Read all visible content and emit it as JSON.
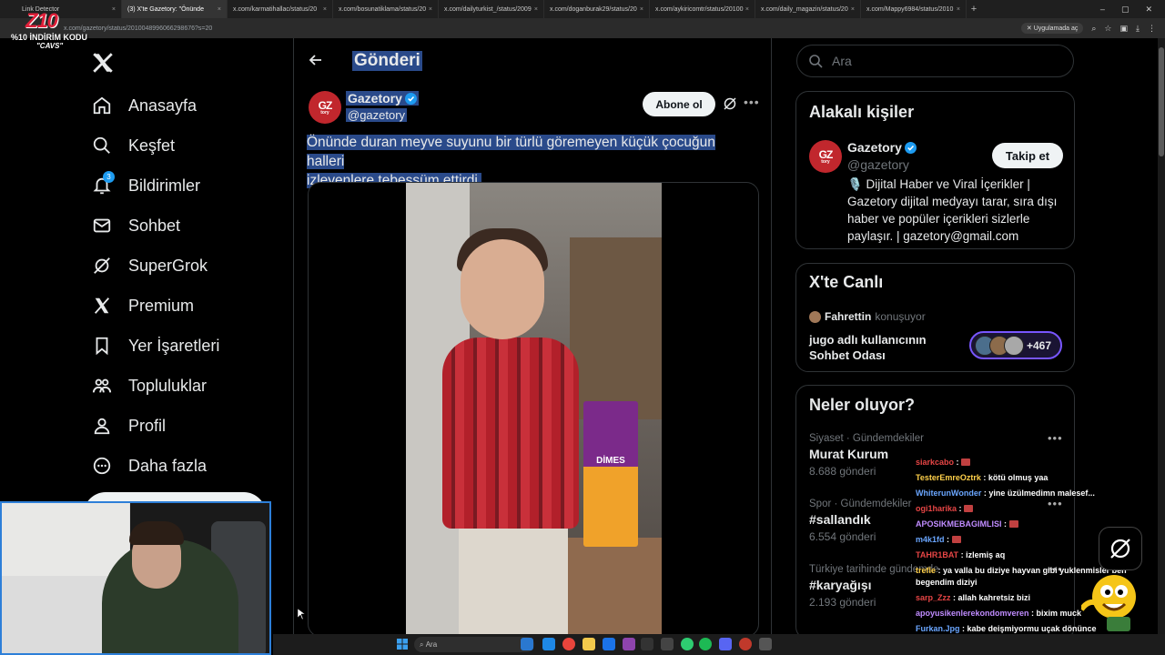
{
  "browser": {
    "tabs": [
      {
        "label": "Link Detector",
        "active": false
      },
      {
        "label": "(3) X'te Gazetory: \"Önünde",
        "active": true
      },
      {
        "label": "x.com/karmatihallac/status/20",
        "active": false
      },
      {
        "label": "x.com/bosunatiklama/status/20",
        "active": false
      },
      {
        "label": "x.com/dailyturkist_/status/2009",
        "active": false
      },
      {
        "label": "x.com/doganburak29/status/20",
        "active": false
      },
      {
        "label": "x.com/aykiricomtr/status/20100",
        "active": false
      },
      {
        "label": "x.com/daily_magazin/status/20",
        "active": false
      },
      {
        "label": "x.com/Mappy6984/status/2010",
        "active": false
      }
    ],
    "url": "x.com/gazetory/status/2010048996066298676?s=20",
    "open_in_app": "Uygulamada aç"
  },
  "stream_overlay": {
    "logo_mark": "Z10",
    "promo_text": "%10 İNDİRİM KODU",
    "promo_code": "\"CAVS\""
  },
  "nav": {
    "items": [
      {
        "label": "Anasayfa",
        "icon": "home-icon"
      },
      {
        "label": "Keşfet",
        "icon": "search-icon"
      },
      {
        "label": "Bildirimler",
        "icon": "bell-icon",
        "badge": "3"
      },
      {
        "label": "Sohbet",
        "icon": "mail-icon"
      },
      {
        "label": "SuperGrok",
        "icon": "grok-icon"
      },
      {
        "label": "Premium",
        "icon": "x-icon"
      },
      {
        "label": "Yer İşaretleri",
        "icon": "bookmark-icon"
      },
      {
        "label": "Topluluklar",
        "icon": "communities-icon"
      },
      {
        "label": "Profil",
        "icon": "profile-icon"
      },
      {
        "label": "Daha fazla",
        "icon": "more-circle-icon"
      }
    ]
  },
  "post": {
    "header_title": "Gönderi",
    "author_name": "Gazetory",
    "author_handle": "@gazetory",
    "avatar_text": "GZ",
    "avatar_sub": "tory",
    "subscribe_label": "Abone ol",
    "text_line1": "Önünde duran meyve suyunu bir türlü göremeyen küçük çocuğun halleri",
    "text_line2": "izleyenlere tebessüm ettirdi.",
    "video_product_label": "DİMES"
  },
  "search": {
    "placeholder": "Ara"
  },
  "related": {
    "title": "Alakalı kişiler",
    "name": "Gazetory",
    "handle": "@gazetory",
    "follow_label": "Takip et",
    "bio": "🎙️ Dijital Haber ve Viral İçerikler | Gazetory dijital medyayı tarar, sıra dışı haber ve popüler içerikleri sizlerle paylaşır. | gazetory@gmail.com"
  },
  "live": {
    "title": "X'te Canlı",
    "host": "Fahrettin",
    "host_status": "konuşuyor",
    "room_title": "jugo adlı kullanıcının Sohbet Odası",
    "listener_count": "+467"
  },
  "trends": {
    "title": "Neler oluyor?",
    "items": [
      {
        "meta": "Siyaset · Gündemdekiler",
        "name": "Murat Kurum",
        "count": "8.688 gönderi"
      },
      {
        "meta": "Spor · Gündemdekiler",
        "name": "#sallandık",
        "count": "6.554 gönderi"
      },
      {
        "meta": "Türkiye tarihinde gündemde",
        "name": "#karyağışı",
        "count": "2.193 gönderi"
      }
    ]
  },
  "chat": [
    {
      "user": "siarkcabo",
      "msg": "",
      "color": "red",
      "emoji": true
    },
    {
      "user": "TesterEmreOztrk",
      "msg": "kötü olmuş yaa",
      "color": "yellow"
    },
    {
      "user": "WhiterunWonder",
      "msg": "yine üzülmedimn malesef...",
      "color": "blue"
    },
    {
      "user": "ogi1harika",
      "msg": "",
      "color": "red",
      "emoji": true
    },
    {
      "user": "APOSIKMEBAGIMLISI",
      "msg": "",
      "color": "purple",
      "emoji": true
    },
    {
      "user": "m4k1fd",
      "msg": "",
      "color": "blue",
      "emoji": true
    },
    {
      "user": "TAHR1BAT",
      "msg": "izlemiş aq",
      "color": "red"
    },
    {
      "user": "trefle",
      "msg": "ya valla bu diziye hayvan gibi yuklenmisler ben begendim diziyi",
      "color": "yellow",
      "wrap": true
    },
    {
      "user": "sarp_Zzz",
      "msg": "allah kahretsiz bizi",
      "color": "red"
    },
    {
      "user": "apoyusikenlerekondomveren",
      "msg": "bixim muck",
      "color": "purple"
    },
    {
      "user": "Furkan.Jpg",
      "msg": "kabe deişmiyormu uçak dönünce",
      "color": "blue"
    }
  ],
  "taskbar": {
    "search_label": "Ara"
  },
  "colors": {
    "accent": "#1d9bf0",
    "selection": "#2a4a8a",
    "live_border": "#7856ff",
    "brand_red": "#c1272d"
  }
}
